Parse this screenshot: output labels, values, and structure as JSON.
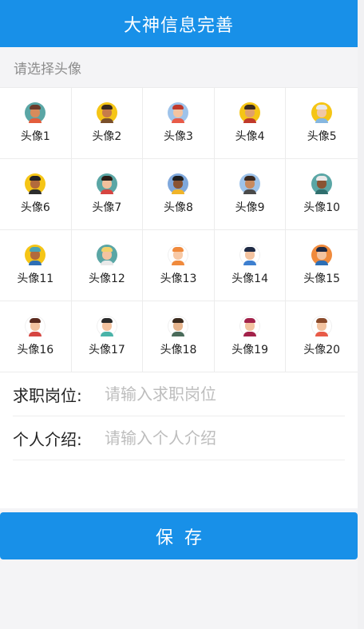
{
  "header": {
    "title": "大神信息完善"
  },
  "avatar_section": {
    "label": "请选择头像"
  },
  "avatars": [
    {
      "label": "头像1",
      "bg": "#5aa6a5",
      "hair": "#6b3b2a",
      "skin": "#d88b5b",
      "shirt": "#e35d3c",
      "icon": "avatar-1-icon"
    },
    {
      "label": "头像2",
      "bg": "#f5c516",
      "hair": "#3a2a1e",
      "skin": "#c67b4a",
      "shirt": "#7a4f2a",
      "icon": "avatar-2-icon"
    },
    {
      "label": "头像3",
      "bg": "#9ec3ea",
      "hair": "#c0392b",
      "skin": "#f3c3a0",
      "shirt": "#e85b48",
      "icon": "avatar-3-icon"
    },
    {
      "label": "头像4",
      "bg": "#f5c516",
      "hair": "#3a2a1e",
      "skin": "#e0a06a",
      "shirt": "#c0392b",
      "icon": "avatar-4-icon"
    },
    {
      "label": "头像5",
      "bg": "#f5c516",
      "hair": "#e9e9e9",
      "skin": "#f1c7a4",
      "shirt": "#86b7e0",
      "icon": "avatar-5-icon"
    },
    {
      "label": "头像6",
      "bg": "#f5c516",
      "hair": "#222222",
      "skin": "#b26a3c",
      "shirt": "#2d2d2d",
      "icon": "avatar-6-icon"
    },
    {
      "label": "头像7",
      "bg": "#5aa6a5",
      "hair": "#2b1d16",
      "skin": "#f2c09c",
      "shirt": "#d64541",
      "icon": "avatar-7-icon"
    },
    {
      "label": "头像8",
      "bg": "#7fa8dc",
      "hair": "#1f1f1f",
      "skin": "#8a5433",
      "shirt": "#f0b429",
      "icon": "avatar-8-icon"
    },
    {
      "label": "头像9",
      "bg": "#9ec3ea",
      "hair": "#3b2a20",
      "skin": "#c98a5e",
      "shirt": "#4a4a4a",
      "icon": "avatar-9-icon"
    },
    {
      "label": "头像10",
      "bg": "#5aa6a5",
      "hair": "#e9e9e9",
      "skin": "#8a5433",
      "shirt": "#2f6f6e",
      "icon": "avatar-10-icon"
    },
    {
      "label": "头像11",
      "bg": "#f5c516",
      "hair": "#4aa3b5",
      "skin": "#b26a3c",
      "shirt": "#2d6fb5",
      "icon": "avatar-11-icon"
    },
    {
      "label": "头像12",
      "bg": "#5aa6a5",
      "hair": "#f2d16b",
      "skin": "#f3c3a0",
      "shirt": "#e9e9e9",
      "icon": "avatar-12-icon"
    },
    {
      "label": "头像13",
      "bg": "#ffffff",
      "hair": "#f08a3c",
      "skin": "#f8c9a6",
      "shirt": "#f08a3c",
      "icon": "avatar-13-icon"
    },
    {
      "label": "头像14",
      "bg": "#ffffff",
      "hair": "#1f2a44",
      "skin": "#f3c3a0",
      "shirt": "#3d7fcf",
      "icon": "avatar-14-icon"
    },
    {
      "label": "头像15",
      "bg": "#f08a3c",
      "hair": "#1f2a44",
      "skin": "#f3c3a0",
      "shirt": "#2d6fb5",
      "icon": "avatar-15-icon"
    },
    {
      "label": "头像16",
      "bg": "#ffffff",
      "hair": "#5a2a1e",
      "skin": "#f3c3a0",
      "shirt": "#d64541",
      "icon": "avatar-16-icon"
    },
    {
      "label": "头像17",
      "bg": "#ffffff",
      "hair": "#2b2b2b",
      "skin": "#f3c3a0",
      "shirt": "#4ab3a8",
      "icon": "avatar-17-icon"
    },
    {
      "label": "头像18",
      "bg": "#ffffff",
      "hair": "#3a2a1e",
      "skin": "#e7b58e",
      "shirt": "#4a6b5a",
      "icon": "avatar-18-icon"
    },
    {
      "label": "头像19",
      "bg": "#ffffff",
      "hair": "#a3224a",
      "skin": "#f3c3a0",
      "shirt": "#a3224a",
      "icon": "avatar-19-icon"
    },
    {
      "label": "头像20",
      "bg": "#ffffff",
      "hair": "#8a4a2a",
      "skin": "#f3c3a0",
      "shirt": "#e85b48",
      "icon": "avatar-20-icon"
    }
  ],
  "form": {
    "job": {
      "label": "求职岗位:",
      "placeholder": "请输入求职岗位",
      "value": ""
    },
    "intro": {
      "label": "个人介绍:",
      "placeholder": "请输入个人介绍",
      "value": ""
    }
  },
  "save_button": {
    "label": "保存"
  },
  "colors": {
    "primary": "#1890e8",
    "background": "#f4f4f6"
  }
}
